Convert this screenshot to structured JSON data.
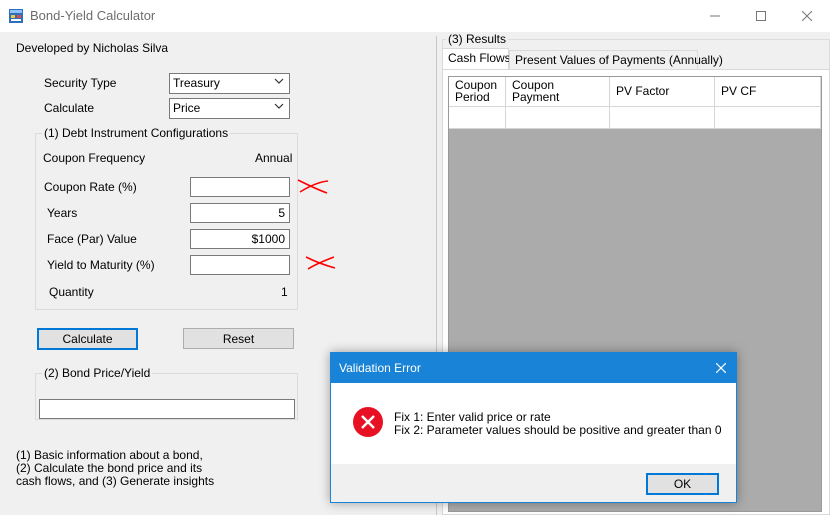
{
  "window": {
    "title": "Bond-Yield Calculator",
    "minimize_icon": "minimize-icon",
    "maximize_icon": "maximize-icon",
    "close_icon": "close-icon"
  },
  "developer_label": "Developed by Nicholas Silva",
  "security_type": {
    "label": "Security Type",
    "value": "Treasury"
  },
  "calculate_mode": {
    "label": "Calculate",
    "value": "Price"
  },
  "config_group": {
    "title": "(1) Debt Instrument Configurations",
    "coupon_frequency": {
      "label": "Coupon Frequency",
      "value": "Annual"
    },
    "coupon_rate": {
      "label": "Coupon Rate (%)",
      "value": ""
    },
    "years": {
      "label": "Years",
      "value": "5"
    },
    "face_value": {
      "label": "Face (Par) Value",
      "value": "$1000"
    },
    "ytm": {
      "label": "Yield to Maturity (%)",
      "value": ""
    },
    "quantity": {
      "label": "Quantity",
      "value": "1"
    }
  },
  "buttons": {
    "calculate": "Calculate",
    "reset": "Reset"
  },
  "price_group": {
    "title": "(2) Bond Price/Yield",
    "value": ""
  },
  "footnote": {
    "line1": "(1) Basic information about a bond,",
    "line2": "(2) Calculate the bond price and its",
    "line3": "cash flows, and (3) Generate insights"
  },
  "results": {
    "title": "(3) Results",
    "tabs": [
      "Cash Flows",
      "Present Values of Payments (Annually)"
    ],
    "columns": [
      {
        "line1": "Coupon",
        "line2": "Period"
      },
      {
        "line1": "Coupon",
        "line2": "Payment"
      },
      {
        "line1": "PV Factor",
        "line2": ""
      },
      {
        "line1": "PV CF",
        "line2": ""
      }
    ]
  },
  "dialog": {
    "title": "Validation Error",
    "icon": "error-icon",
    "line1": "Fix 1: Enter valid price or rate",
    "line2": "Fix 2: Parameter values should be positive and greater than 0",
    "ok_label": "OK"
  },
  "annotations": {
    "mark_color": "#ff0000",
    "mark_icon": "red-cross-mark-icon"
  },
  "colors": {
    "accent": "#0078d7",
    "dialog_title": "#1883d7",
    "error": "#e81123"
  }
}
